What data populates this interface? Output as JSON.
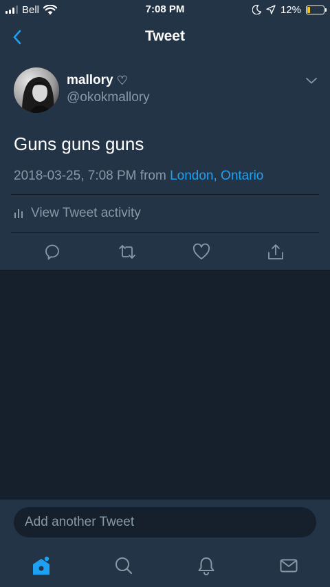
{
  "status_bar": {
    "carrier": "Bell",
    "time": "7:08 PM",
    "battery": "12%",
    "battery_level": 0.12,
    "icons": [
      "signal-icon",
      "wifi-icon",
      "moon-icon",
      "location-arrow-icon",
      "battery-icon"
    ]
  },
  "nav": {
    "title": "Tweet",
    "back_icon": "chevron-left-icon"
  },
  "tweet": {
    "author_name": "mallory",
    "author_heart": "♡",
    "handle": "@okokmallory",
    "text": "Guns guns guns",
    "timestamp": "2018-03-25, 7:08 PM",
    "from_word": "from",
    "location_city": "London",
    "location_sep": ",",
    "location_region": "Ontario",
    "activity_label": "View Tweet activity"
  },
  "actions": [
    "reply-icon",
    "retweet-icon",
    "like-icon",
    "share-icon"
  ],
  "reply": {
    "placeholder": "Add another Tweet"
  },
  "tabs": [
    "home-icon",
    "search-icon",
    "notifications-icon",
    "messages-icon"
  ],
  "colors": {
    "background": "#16202c",
    "surface": "#243447",
    "accent": "#1da1f2",
    "secondary_text": "#8899a6",
    "battery_low": "#f5c518"
  }
}
